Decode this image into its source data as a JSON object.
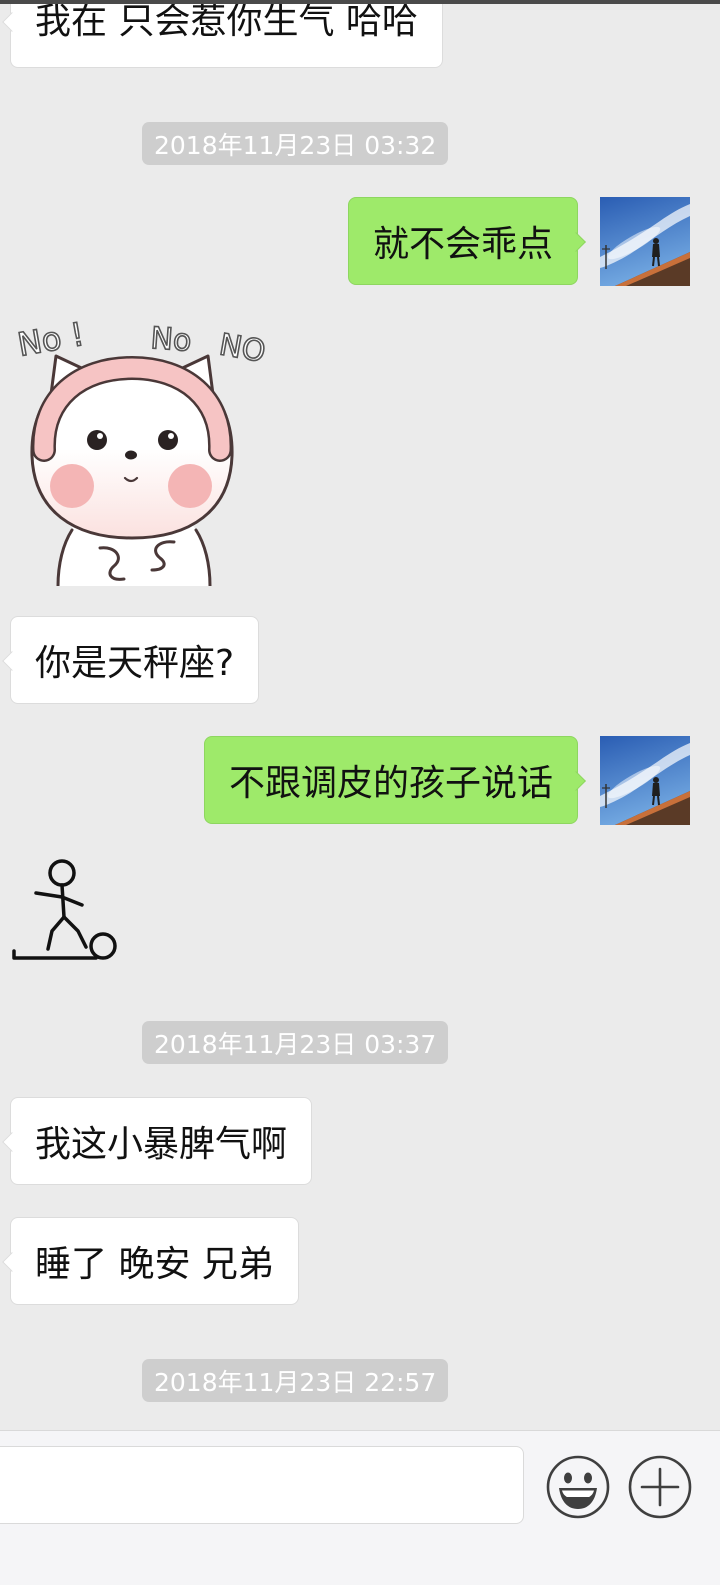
{
  "chat": {
    "messages": [
      {
        "incoming_text": "我在 只会惹你生气 哈哈"
      },
      {
        "timestamp": "2018年11月23日 03:32"
      },
      {
        "outgoing_text": "就不会乖点",
        "avatar_icon": "sky-rooftop-avatar-icon"
      },
      {
        "incoming_sticker_icon": "bear-no-no-sticker-icon",
        "sticker_lettering": [
          "No !",
          "No",
          "NO"
        ]
      },
      {
        "incoming_text": "你是天秤座?"
      },
      {
        "outgoing_text": "不跟调皮的孩子说话",
        "avatar_icon": "sky-rooftop-avatar-icon"
      },
      {
        "incoming_sticker_icon": "stickman-kicking-ball-sticker-icon"
      },
      {
        "timestamp": "2018年11月23日 03:37"
      },
      {
        "incoming_text": "我这小暴脾气啊"
      },
      {
        "incoming_text": "睡了 晚安 兄弟"
      },
      {
        "timestamp": "2018年11月23日 22:57"
      }
    ]
  },
  "input_bar": {
    "message_field_value": "",
    "emoji_button_icon": "smiley-face-icon",
    "more_button_icon": "plus-icon"
  },
  "colors": {
    "chat_background": "#ebebeb",
    "incoming_bubble": "#ffffff",
    "outgoing_bubble": "#9eea6a",
    "timestamp_pill": "#cecece",
    "timestamp_text": "#ffffff",
    "input_bar_background": "#f5f5f7"
  }
}
